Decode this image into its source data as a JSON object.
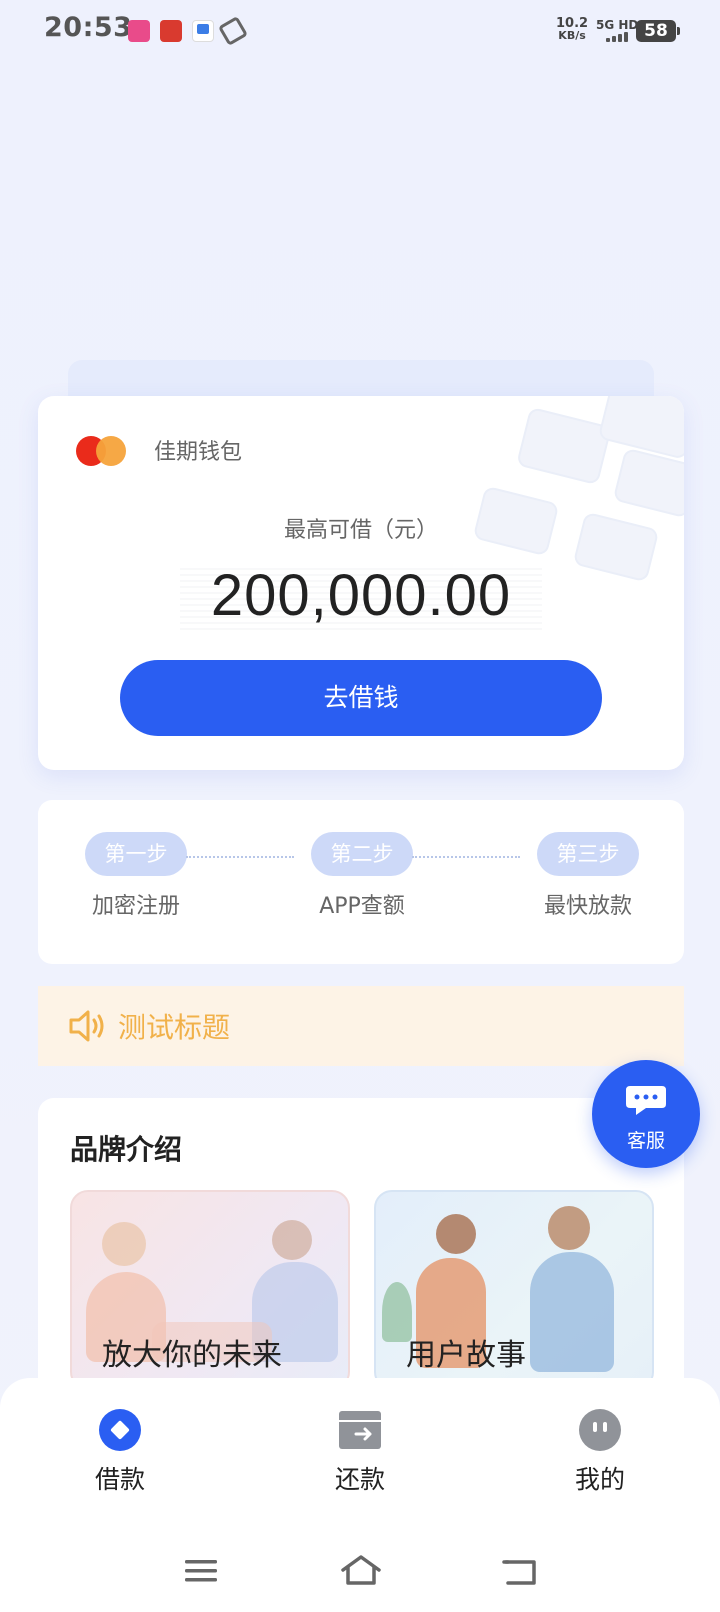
{
  "status_bar": {
    "time": "20:53",
    "net_speed": "10.2",
    "net_unit": "KB/s",
    "network": "5G HD",
    "battery": "58"
  },
  "card": {
    "brand_name": "佳期钱包",
    "limit_label": "最高可借（元）",
    "amount": "200,000.00",
    "borrow_button": "去借钱",
    "logo_colors": [
      "#ea2b1b",
      "#f5a33b"
    ]
  },
  "steps": [
    {
      "badge": "第一步",
      "caption": "加密注册"
    },
    {
      "badge": "第二步",
      "caption": "APP查额"
    },
    {
      "badge": "第三步",
      "caption": "最快放款"
    }
  ],
  "notice": {
    "icon": "speaker-icon",
    "title": "测试标题"
  },
  "intro": {
    "heading": "品牌介绍",
    "tiles": [
      {
        "label": "放大你的未来"
      },
      {
        "label": "用户故事"
      }
    ]
  },
  "chat": {
    "icon": "chat-icon",
    "label": "客服"
  },
  "tabbar": {
    "items": [
      {
        "label": "借款",
        "icon": "loan-icon",
        "active": true
      },
      {
        "label": "还款",
        "icon": "repay-icon",
        "active": false
      },
      {
        "label": "我的",
        "icon": "profile-icon",
        "active": false
      }
    ]
  },
  "colors": {
    "primary": "#2a5ef2",
    "notice_text": "#f1b14a",
    "step_pill": "#cdd9f8"
  }
}
